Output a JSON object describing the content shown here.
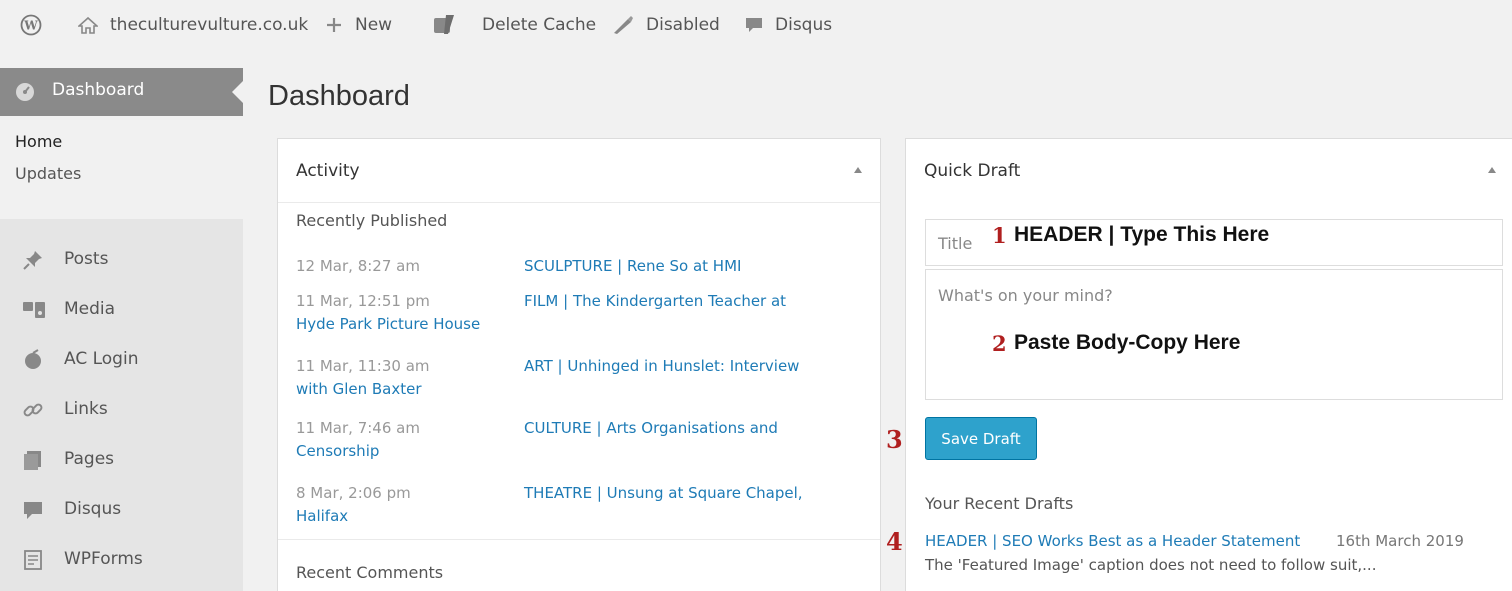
{
  "adminbar": {
    "site_name": "theculturevulture.co.uk",
    "new_label": "New",
    "delete_cache_label": "Delete Cache",
    "disabled_label": "Disabled",
    "disqus_label": "Disqus"
  },
  "sidebar": {
    "dashboard_label": "Dashboard",
    "submenu": [
      "Home",
      "Updates"
    ],
    "items": [
      "Posts",
      "Media",
      "AC Login",
      "Links",
      "Pages",
      "Disqus",
      "WPForms"
    ]
  },
  "page_title": "Dashboard",
  "activity": {
    "title": "Activity",
    "recently_published": "Recently Published",
    "posts": [
      {
        "date": "12 Mar, 8:27 am",
        "title": "SCULPTURE | Rene So at HMI",
        "wrap": ""
      },
      {
        "date": "11 Mar, 12:51 pm",
        "title": "FILM | The Kindergarten Teacher at",
        "wrap": "Hyde Park Picture House"
      },
      {
        "date": "11 Mar, 11:30 am",
        "title": "ART | Unhinged in Hunslet: Interview",
        "wrap": "with Glen Baxter"
      },
      {
        "date": "11 Mar, 7:46 am",
        "title": "CULTURE | Arts Organisations and",
        "wrap": "Censorship"
      },
      {
        "date": "8 Mar, 2:06 pm",
        "title": "THEATRE | Unsung at Square Chapel,",
        "wrap": "Halifax"
      }
    ],
    "recent_comments": "Recent Comments"
  },
  "quick_draft": {
    "title": "Quick Draft",
    "title_placeholder": "Title",
    "body_placeholder": "What's on your mind?",
    "save_label": "Save Draft",
    "recent_drafts_heading": "Your Recent Drafts",
    "draft_title": "HEADER | SEO Works Best as a Header Statement",
    "draft_date": "16th March 2019",
    "draft_excerpt": "The 'Featured Image' caption does not need to follow suit,..."
  },
  "annotations": {
    "n1": "1",
    "t1": "HEADER | Type This Here",
    "n2": "2",
    "t2": "Paste Body-Copy Here",
    "n3": "3",
    "n4": "4"
  },
  "colors": {
    "link": "#1e7bb6",
    "button": "#2ea2cc",
    "annotation_number": "#b01f1f",
    "sidebar_active": "#8a8a8a"
  }
}
